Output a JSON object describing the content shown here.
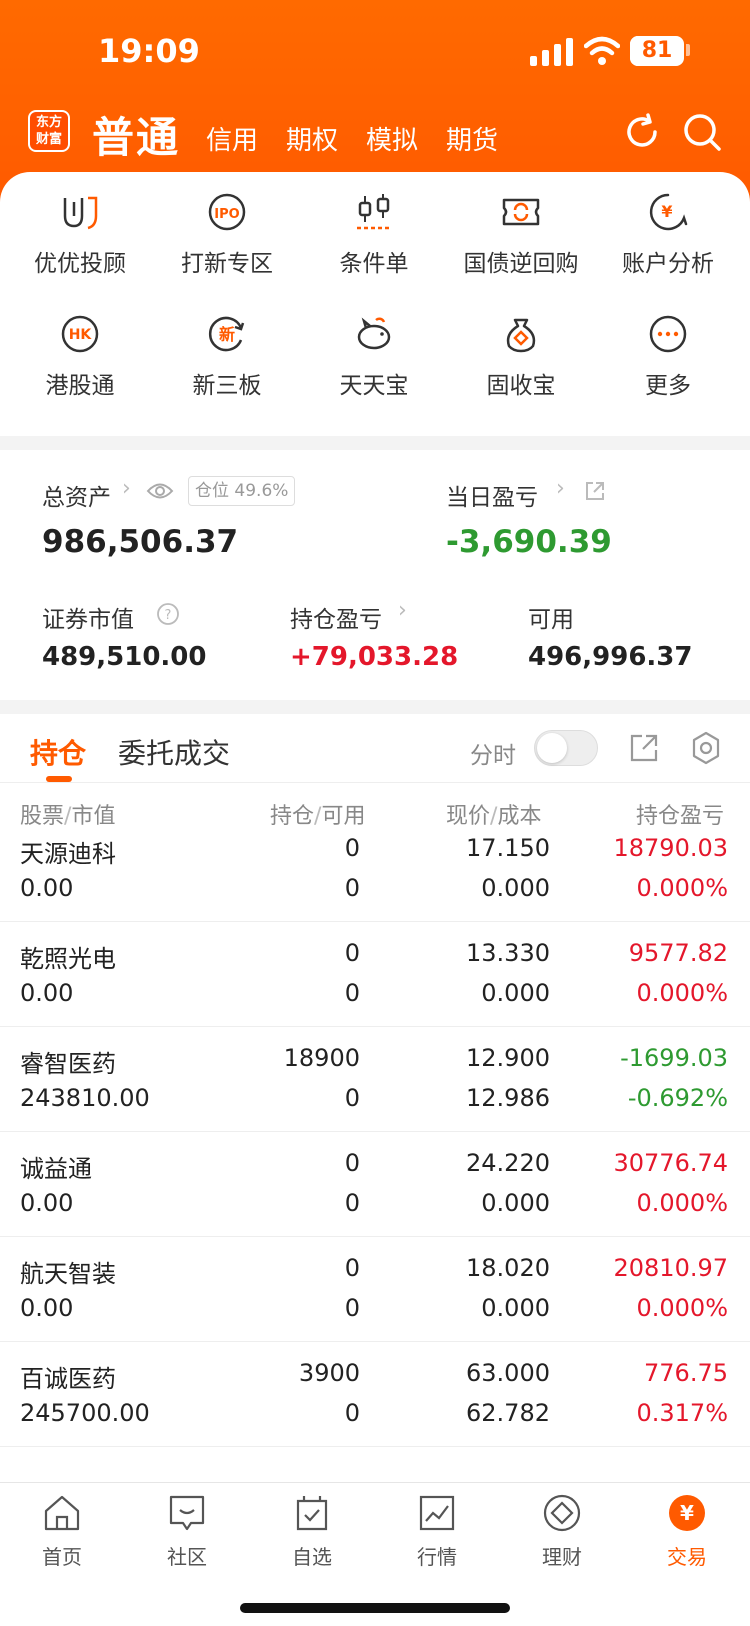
{
  "status_bar": {
    "time": "19:09",
    "battery_level": "81",
    "battery_fraction": 0.81
  },
  "header": {
    "logo_text": [
      "东方",
      "财富"
    ],
    "active_tab": "普通",
    "tabs": [
      "信用",
      "期权",
      "模拟",
      "期货"
    ]
  },
  "services": [
    {
      "label": "优优投顾",
      "icon": "uu-advisor-icon"
    },
    {
      "label": "打新专区",
      "icon": "ipo-icon",
      "icon_text": "IPO"
    },
    {
      "label": "条件单",
      "icon": "candlestick-icon"
    },
    {
      "label": "国债逆回购",
      "icon": "repo-ticket-icon"
    },
    {
      "label": "账户分析",
      "icon": "yuan-chat-icon",
      "icon_text": "¥"
    },
    {
      "label": "港股通",
      "icon": "hk-icon",
      "icon_text": "HK"
    },
    {
      "label": "新三板",
      "icon": "new-board-icon",
      "icon_text": "新"
    },
    {
      "label": "天天宝",
      "icon": "piggy-bank-icon"
    },
    {
      "label": "固收宝",
      "icon": "money-bag-icon"
    },
    {
      "label": "更多",
      "icon": "more-dots-icon"
    }
  ],
  "assets": {
    "total_label": "总资产",
    "total_value": "986,506.37",
    "position_badge": "仓位 49.6%",
    "daily_pnl_label": "当日盈亏",
    "daily_pnl_value": "-3,690.39",
    "market_value_label": "证券市值",
    "market_value": "489,510.00",
    "holding_pnl_label": "持仓盈亏",
    "holding_pnl": "+79,033.28",
    "available_label": "可用",
    "available_value": "496,996.37"
  },
  "holdings": {
    "tab_active": "持仓",
    "tab_other": "委托成交",
    "fenshi_label": "分时",
    "columns": [
      {
        "a": "股票",
        "b": "市值"
      },
      {
        "a": "持仓",
        "b": "可用"
      },
      {
        "a": "现价",
        "b": "成本"
      },
      {
        "a": "持仓盈亏",
        "b": ""
      }
    ],
    "rows": [
      {
        "name": "天源迪科",
        "market_value": "0.00",
        "position": "0",
        "available": "0",
        "price": "17.150",
        "cost": "0.000",
        "pnl": "18790.03",
        "pnl_pct": "0.000%",
        "trend": "up"
      },
      {
        "name": "乾照光电",
        "market_value": "0.00",
        "position": "0",
        "available": "0",
        "price": "13.330",
        "cost": "0.000",
        "pnl": "9577.82",
        "pnl_pct": "0.000%",
        "trend": "up"
      },
      {
        "name": "睿智医药",
        "market_value": "243810.00",
        "position": "18900",
        "available": "0",
        "price": "12.900",
        "cost": "12.986",
        "pnl": "-1699.03",
        "pnl_pct": "-0.692%",
        "trend": "down"
      },
      {
        "name": "诚益通",
        "market_value": "0.00",
        "position": "0",
        "available": "0",
        "price": "24.220",
        "cost": "0.000",
        "pnl": "30776.74",
        "pnl_pct": "0.000%",
        "trend": "up"
      },
      {
        "name": "航天智装",
        "market_value": "0.00",
        "position": "0",
        "available": "0",
        "price": "18.020",
        "cost": "0.000",
        "pnl": "20810.97",
        "pnl_pct": "0.000%",
        "trend": "up"
      },
      {
        "name": "百诚医药",
        "market_value": "245700.00",
        "position": "3900",
        "available": "0",
        "price": "63.000",
        "cost": "62.782",
        "pnl": "776.75",
        "pnl_pct": "0.317%",
        "trend": "up"
      }
    ]
  },
  "tabbar": [
    {
      "label": "首页",
      "icon": "home-icon"
    },
    {
      "label": "社区",
      "icon": "community-icon"
    },
    {
      "label": "自选",
      "icon": "watchlist-icon"
    },
    {
      "label": "行情",
      "icon": "market-chart-icon"
    },
    {
      "label": "理财",
      "icon": "wealth-diamond-icon"
    },
    {
      "label": "交易",
      "icon": "trade-yuan-icon",
      "icon_text": "¥",
      "active": true
    }
  ],
  "colors": {
    "brand": "#ff5a00",
    "up": "#e4172b",
    "down": "#2e9a31"
  }
}
